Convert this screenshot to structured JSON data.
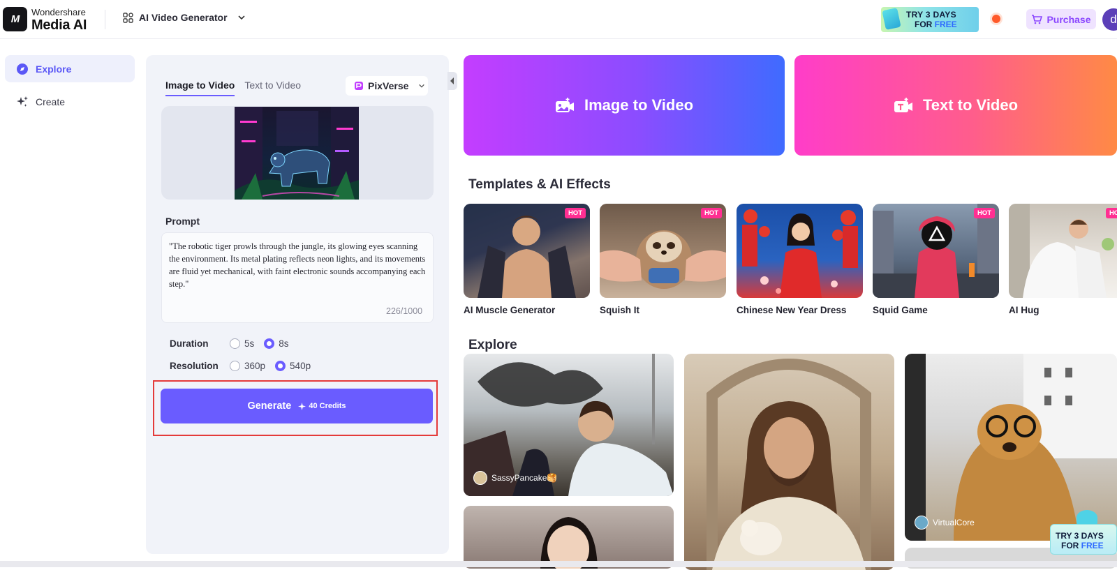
{
  "header": {
    "brand_line1": "Wondershare",
    "brand_line2": "Media AI",
    "logo_mark": "M",
    "product": "AI Video Generator",
    "promo_line1": "TRY 3 DAYS",
    "promo_line2_a": "FOR ",
    "promo_line2_b": "FREE",
    "purchase_label": "Purchase",
    "avatar_initial": "d"
  },
  "sidebar": {
    "items": [
      {
        "label": "Explore",
        "icon": "compass-icon",
        "active": true
      },
      {
        "label": "Create",
        "icon": "sparkle-icon",
        "active": false
      }
    ]
  },
  "form": {
    "tabs": [
      {
        "label": "Image to Video",
        "active": true
      },
      {
        "label": "Text to Video",
        "active": false
      }
    ],
    "model": "PixVerse",
    "prompt_label": "Prompt",
    "prompt_text": "\"The robotic tiger prowls through the jungle, its glowing eyes scanning the environment. Its metal plating reflects neon lights, and its movements are fluid yet mechanical, with faint electronic sounds accompanying each step.\"",
    "prompt_count": "226/1000",
    "duration": {
      "label": "Duration",
      "options": [
        "5s",
        "8s"
      ],
      "selected": "8s"
    },
    "resolution": {
      "label": "Resolution",
      "options": [
        "360p",
        "540p"
      ],
      "selected": "540p"
    },
    "generate_label": "Generate",
    "credits_label": "40 Credits"
  },
  "modes": [
    {
      "label": "Image to Video",
      "icon": "image-video-icon"
    },
    {
      "label": "Text to Video",
      "icon": "text-video-icon"
    }
  ],
  "templates": {
    "title": "Templates & AI Effects",
    "hot_label": "HOT",
    "items": [
      {
        "name": "AI Muscle Generator",
        "hot": true
      },
      {
        "name": "Squish It",
        "hot": true
      },
      {
        "name": "Chinese New Year Dress",
        "hot": false
      },
      {
        "name": "Squid Game",
        "hot": true
      },
      {
        "name": "AI Hug",
        "hot": true
      }
    ]
  },
  "explore": {
    "title": "Explore",
    "cards": [
      {
        "user": "SassyPancake🥞"
      },
      {
        "user": ""
      },
      {
        "user": "VirtualCore"
      },
      {
        "user": ""
      }
    ]
  },
  "float_promo": {
    "line1": "TRY 3 DAYS",
    "line2_a": "FOR ",
    "line2_b": "FREE"
  },
  "colors": {
    "accent": "#6a5cff",
    "highlight_outline": "#e43a3a",
    "hot_badge": "#ff2f92"
  }
}
